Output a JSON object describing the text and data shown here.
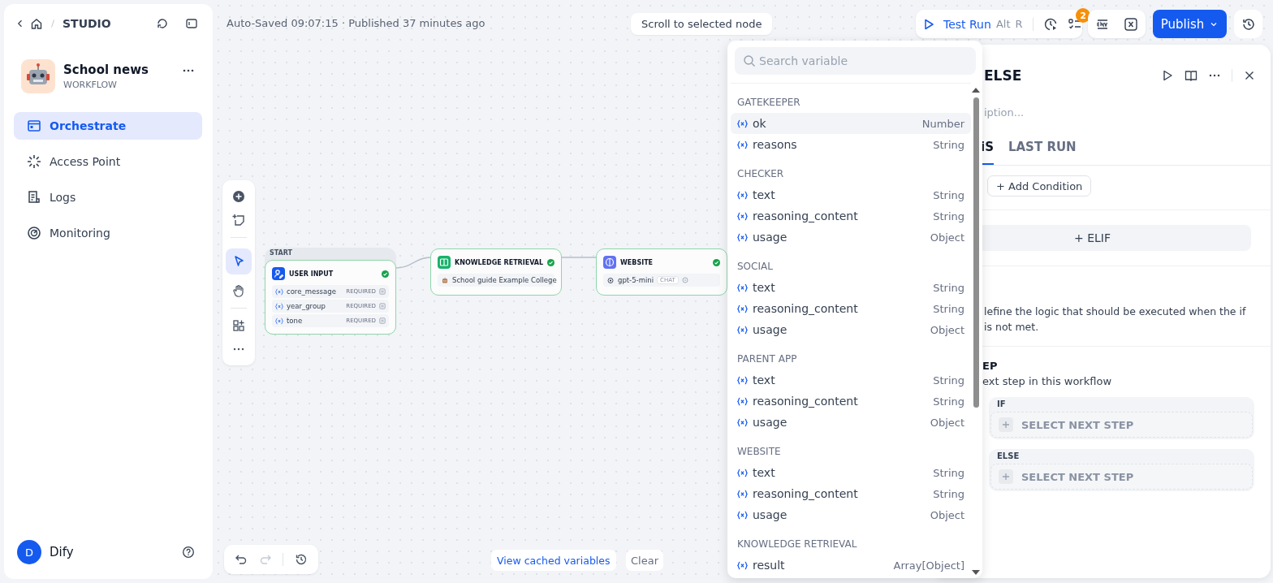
{
  "breadcrumb": {
    "label": "STUDIO"
  },
  "app": {
    "name": "School news",
    "type": "WORKFLOW"
  },
  "nav": [
    {
      "label": "Orchestrate",
      "selected": true
    },
    {
      "label": "Access Point",
      "selected": false
    },
    {
      "label": "Logs",
      "selected": false
    },
    {
      "label": "Monitoring",
      "selected": false
    }
  ],
  "user": {
    "initial": "D",
    "name": "Dify"
  },
  "status": "Auto-Saved 09:07:15 · Published 37 minutes ago",
  "scroll_hint": "Scroll to selected node",
  "test_run": {
    "label": "Test Run",
    "keys": [
      "Alt",
      "R"
    ],
    "badge": "2"
  },
  "publish": "Publish",
  "nodes": [
    {
      "kind": "start",
      "group_label": "START",
      "title": "USER INPUT",
      "vars": [
        {
          "name": "core_message",
          "tag": "REQUIRED"
        },
        {
          "name": "year_group",
          "tag": "REQUIRED"
        },
        {
          "name": "tone",
          "tag": "REQUIRED"
        }
      ]
    },
    {
      "kind": "knowledge",
      "title": "KNOWLEDGE RETRIEVAL",
      "detail": "School guide Example College"
    },
    {
      "kind": "llm",
      "title": "WEBSITE",
      "model": "gpt-5-mini",
      "mode": "CHAT"
    }
  ],
  "cache": {
    "link": "View cached variables",
    "clear": "Clear"
  },
  "variable_picker": {
    "placeholder": "Search variable",
    "groups": [
      {
        "title": "GATEKEEPER",
        "vars": [
          {
            "name": "ok",
            "type": "Number",
            "selected": true
          },
          {
            "name": "reasons",
            "type": "String",
            "selected": false
          }
        ]
      },
      {
        "title": "CHECKER",
        "vars": [
          {
            "name": "text",
            "type": "String",
            "selected": false
          },
          {
            "name": "reasoning_content",
            "type": "String",
            "selected": false
          },
          {
            "name": "usage",
            "type": "Object",
            "selected": false
          }
        ]
      },
      {
        "title": "SOCIAL",
        "vars": [
          {
            "name": "text",
            "type": "String",
            "selected": false
          },
          {
            "name": "reasoning_content",
            "type": "String",
            "selected": false
          },
          {
            "name": "usage",
            "type": "Object",
            "selected": false
          }
        ]
      },
      {
        "title": "PARENT APP",
        "vars": [
          {
            "name": "text",
            "type": "String",
            "selected": false
          },
          {
            "name": "reasoning_content",
            "type": "String",
            "selected": false
          },
          {
            "name": "usage",
            "type": "Object",
            "selected": false
          }
        ]
      },
      {
        "title": "WEBSITE",
        "vars": [
          {
            "name": "text",
            "type": "String",
            "selected": false
          },
          {
            "name": "reasoning_content",
            "type": "String",
            "selected": false
          },
          {
            "name": "usage",
            "type": "Object",
            "selected": false
          }
        ]
      },
      {
        "title": "KNOWLEDGE RETRIEVAL",
        "vars": [
          {
            "name": "result",
            "type": "Array[Object]",
            "selected": false
          }
        ]
      }
    ]
  },
  "panel": {
    "title": "ELSE",
    "description_placeholder": "iption...",
    "tabs": [
      {
        "label": "iS",
        "selected": true
      },
      {
        "label": "LAST RUN",
        "selected": false
      }
    ],
    "add_condition": "+ Add Condition",
    "elif": "+ ELIF",
    "else_text": [
      "lefine the logic that should be executed when the if",
      "is not met."
    ],
    "next_step_title": "EP",
    "next_step_text": "ext step in this workflow",
    "branches": [
      {
        "label": "IF",
        "action": "SELECT NEXT STEP"
      },
      {
        "label": "ELSE",
        "action": "SELECT NEXT STEP"
      }
    ]
  }
}
